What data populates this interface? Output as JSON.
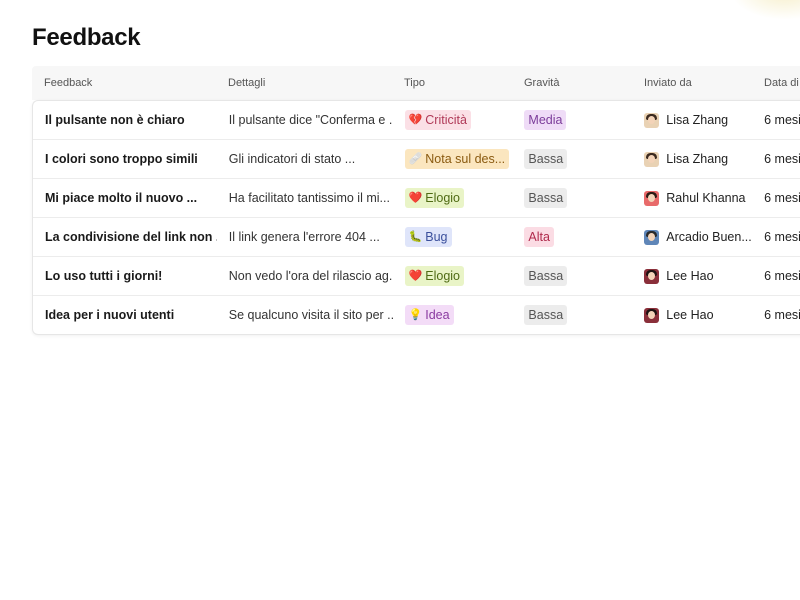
{
  "page": {
    "title": "Feedback"
  },
  "table": {
    "columns": [
      "Feedback",
      "Dettagli",
      "Tipo",
      "Gravità",
      "Inviato da",
      "Data di"
    ],
    "rows": [
      {
        "feedback": "Il pulsante non è chiaro",
        "details": "Il pulsante dice \"Conferma e ...",
        "type": {
          "emoji": "💔",
          "label": "Criticità",
          "bg": "#fbe0e6",
          "fg": "#b03a58"
        },
        "severity": {
          "label": "Media",
          "bg": "#efdcf7",
          "fg": "#7b3c9a"
        },
        "submitter": {
          "name": "Lisa Zhang",
          "avatar": "lisa"
        },
        "date": "6 mesi"
      },
      {
        "feedback": "I colori sono troppo simili",
        "details": "Gli indicatori di stato ...",
        "type": {
          "emoji": "🩹",
          "label": "Nota sul des...",
          "bg": "#fbe6bf",
          "fg": "#8a5a10"
        },
        "severity": {
          "label": "Bassa",
          "bg": "#ececec",
          "fg": "#555555"
        },
        "submitter": {
          "name": "Lisa Zhang",
          "avatar": "lisa"
        },
        "date": "6 mesi"
      },
      {
        "feedback": "Mi piace molto il nuovo ...",
        "details": "Ha facilitato tantissimo il mi...",
        "type": {
          "emoji": "❤️",
          "label": "Elogio",
          "bg": "#e9f4c7",
          "fg": "#4f6b14"
        },
        "severity": {
          "label": "Bassa",
          "bg": "#ececec",
          "fg": "#555555"
        },
        "submitter": {
          "name": "Rahul Khanna",
          "avatar": "rahul"
        },
        "date": "6 mesi"
      },
      {
        "feedback": "La condivisione del link non ...",
        "details": "Il link genera l'errore 404 ...",
        "type": {
          "emoji": "🐛",
          "label": "Bug",
          "bg": "#dfe5fa",
          "fg": "#3a4f9c"
        },
        "severity": {
          "label": "Alta",
          "bg": "#fbdce4",
          "fg": "#b02a4c"
        },
        "submitter": {
          "name": "Arcadio Buen...",
          "avatar": "arcadio"
        },
        "date": "6 mesi"
      },
      {
        "feedback": "Lo uso tutti i giorni!",
        "details": "Non vedo l'ora del rilascio ag...",
        "type": {
          "emoji": "❤️",
          "label": "Elogio",
          "bg": "#e9f4c7",
          "fg": "#4f6b14"
        },
        "severity": {
          "label": "Bassa",
          "bg": "#ececec",
          "fg": "#555555"
        },
        "submitter": {
          "name": "Lee Hao",
          "avatar": "lee"
        },
        "date": "6 mesi"
      },
      {
        "feedback": "Idea per i nuovi utenti",
        "details": "Se qualcuno visita il sito per ...",
        "type": {
          "emoji": "💡",
          "label": "Idea",
          "bg": "#f3dcf7",
          "fg": "#8a3aa0"
        },
        "severity": {
          "label": "Bassa",
          "bg": "#ececec",
          "fg": "#555555"
        },
        "submitter": {
          "name": "Lee Hao",
          "avatar": "lee"
        },
        "date": "6 mesi"
      }
    ]
  },
  "avatars": {
    "lisa": {
      "bg": "#e9d2b4",
      "hair": "#3b2a20"
    },
    "rahul": {
      "bg": "#e86a6a",
      "hair": "#2b1b14"
    },
    "arcadio": {
      "bg": "#5f86b8",
      "hair": "#2a2a2a"
    },
    "lee": {
      "bg": "#8a2f3a",
      "hair": "#1e1212"
    }
  }
}
